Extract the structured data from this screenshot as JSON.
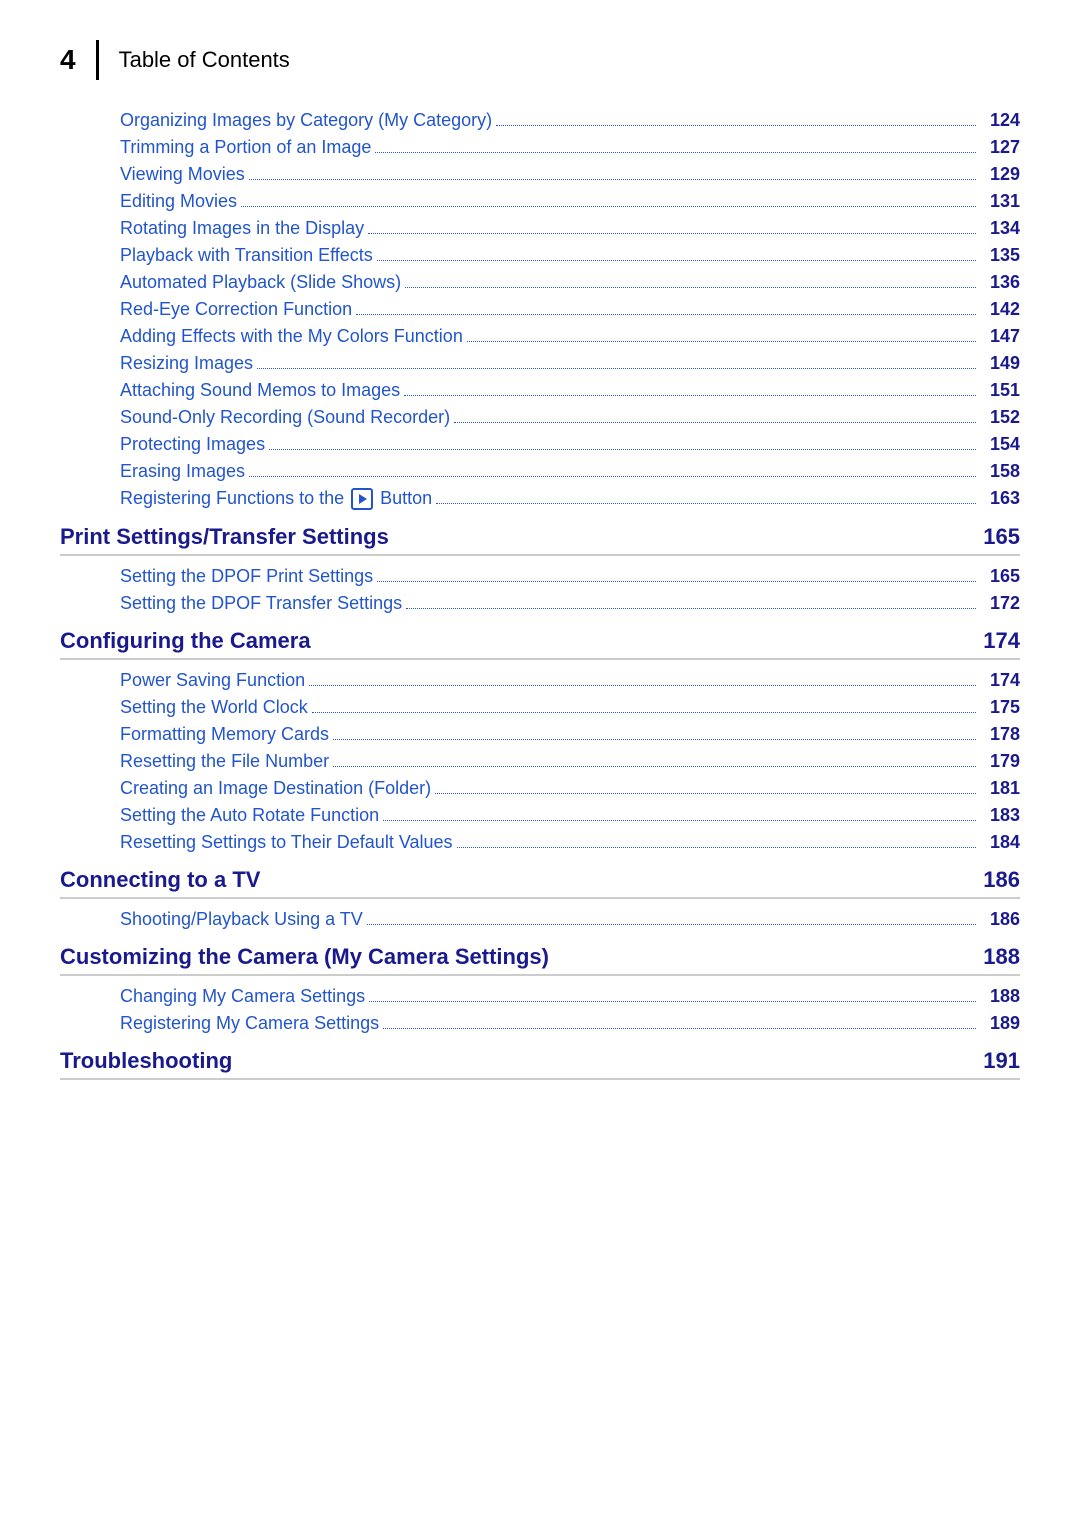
{
  "header": {
    "page_number": "4",
    "title": "Table of Contents"
  },
  "entries": [
    {
      "type": "sub",
      "label": "Organizing Images by Category (My Category)",
      "dots": true,
      "page": "124"
    },
    {
      "type": "sub",
      "label": "Trimming a Portion of an Image",
      "dots": true,
      "page": "127"
    },
    {
      "type": "sub",
      "label": "Viewing Movies",
      "dots": true,
      "page": "129"
    },
    {
      "type": "sub",
      "label": "Editing Movies",
      "dots": true,
      "page": "131"
    },
    {
      "type": "sub",
      "label": "Rotating Images in the Display",
      "dots": true,
      "page": "134"
    },
    {
      "type": "sub",
      "label": "Playback with Transition Effects",
      "dots": true,
      "page": "135"
    },
    {
      "type": "sub",
      "label": "Automated Playback (Slide Shows)",
      "dots": true,
      "page": "136"
    },
    {
      "type": "sub",
      "label": "Red-Eye Correction Function",
      "dots": true,
      "page": "142"
    },
    {
      "type": "sub",
      "label": "Adding Effects with the My Colors Function",
      "dots": true,
      "page": "147"
    },
    {
      "type": "sub",
      "label": "Resizing Images",
      "dots": true,
      "page": "149"
    },
    {
      "type": "sub",
      "label": "Attaching Sound Memos to Images",
      "dots": true,
      "page": "151"
    },
    {
      "type": "sub",
      "label": "Sound-Only Recording (Sound Recorder)",
      "dots": true,
      "page": "152"
    },
    {
      "type": "sub",
      "label": "Protecting Images",
      "dots": true,
      "page": "154"
    },
    {
      "type": "sub",
      "label": "Erasing Images",
      "dots": true,
      "page": "158"
    },
    {
      "type": "sub-icon",
      "label_before": "Registering Functions to the ",
      "label_after": " Button",
      "dots": true,
      "page": "163"
    },
    {
      "type": "section",
      "label": "Print Settings/Transfer Settings",
      "page": "165"
    },
    {
      "type": "sub",
      "label": "Setting the DPOF Print Settings",
      "dots": true,
      "page": "165"
    },
    {
      "type": "sub",
      "label": "Setting the DPOF Transfer Settings",
      "dots": true,
      "page": "172"
    },
    {
      "type": "section",
      "label": "Configuring the Camera",
      "page": "174"
    },
    {
      "type": "sub",
      "label": "Power Saving Function",
      "dots": true,
      "page": "174"
    },
    {
      "type": "sub",
      "label": "Setting the World Clock",
      "dots": true,
      "page": "175"
    },
    {
      "type": "sub",
      "label": "Formatting Memory Cards",
      "dots": true,
      "page": "178"
    },
    {
      "type": "sub",
      "label": "Resetting the File Number",
      "dots": true,
      "page": "179"
    },
    {
      "type": "sub",
      "label": "Creating an Image Destination (Folder)",
      "dots": true,
      "page": "181"
    },
    {
      "type": "sub",
      "label": "Setting the Auto Rotate Function",
      "dots": true,
      "page": "183"
    },
    {
      "type": "sub",
      "label": "Resetting Settings to Their Default Values",
      "dots": true,
      "page": "184"
    },
    {
      "type": "section",
      "label": "Connecting to a TV",
      "page": "186"
    },
    {
      "type": "sub",
      "label": "Shooting/Playback Using a TV",
      "dots": true,
      "page": "186"
    },
    {
      "type": "section",
      "label": "Customizing the Camera (My Camera Settings)",
      "page": "188"
    },
    {
      "type": "sub",
      "label": "Changing My Camera Settings",
      "dots": true,
      "page": "188"
    },
    {
      "type": "sub",
      "label": "Registering My Camera Settings",
      "dots": true,
      "page": "189"
    },
    {
      "type": "section",
      "label": "Troubleshooting",
      "page": "191"
    }
  ]
}
